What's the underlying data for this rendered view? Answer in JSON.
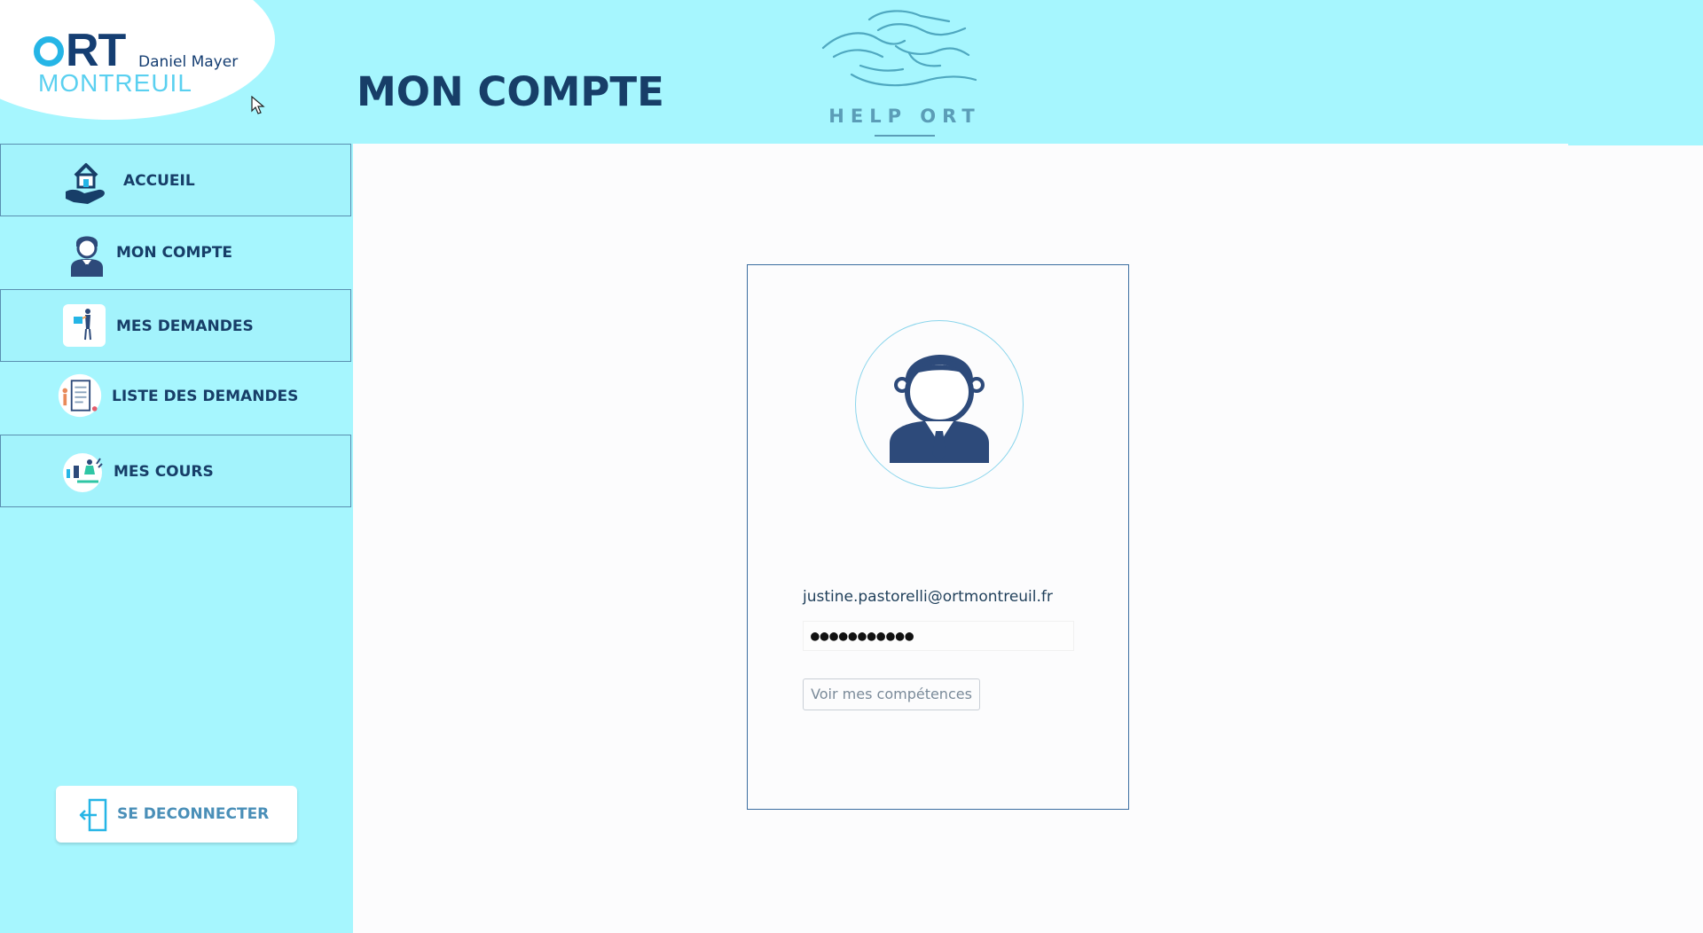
{
  "brand": {
    "ort_rest": "RT",
    "daniel_mayer": "Daniel Mayer",
    "city": "MONTREUIL"
  },
  "header": {
    "page_title": "MON COMPTE",
    "help_logo_text": "HELP ORT"
  },
  "sidebar": {
    "items": [
      {
        "label": "ACCUEIL",
        "icon": "house-hand-icon"
      },
      {
        "label": "MON COMPTE",
        "icon": "user-icon"
      },
      {
        "label": "MES DEMANDES",
        "icon": "requests-illustration-icon"
      },
      {
        "label": "LISTE DES DEMANDES",
        "icon": "request-list-illustration-icon"
      },
      {
        "label": "MES COURS",
        "icon": "courses-illustration-icon"
      }
    ],
    "logout_label": "SE DECONNECTER"
  },
  "account": {
    "email": "justine.pastorelli@ortmontreuil.fr",
    "password_masked": "●●●●●●●●●●●",
    "skills_button": "Voir mes compétences"
  },
  "colors": {
    "header_bg": "#a6f6fe",
    "navy": "#173e68",
    "accent_blue": "#25b5e6",
    "content_bg": "#fcfcfd"
  }
}
